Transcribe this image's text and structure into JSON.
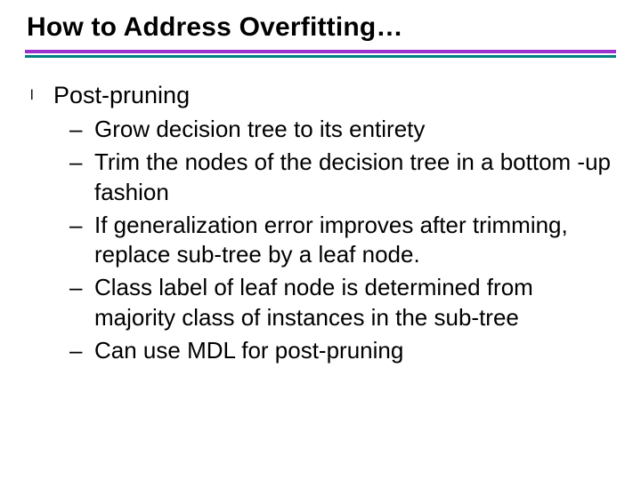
{
  "title": "How to Address Overfitting…",
  "lvl1_bullet": "l",
  "lvl2_dash": "–",
  "body": {
    "heading": "Post-pruning",
    "items": [
      "Grow decision tree to its entirety",
      "Trim the nodes of the decision tree in a bottom -up fashion",
      "If generalization error improves after trimming, replace sub-tree by a leaf node.",
      "Class label of leaf node is determined from majority class of instances in the sub-tree",
      "Can use MDL for post-pruning"
    ]
  }
}
